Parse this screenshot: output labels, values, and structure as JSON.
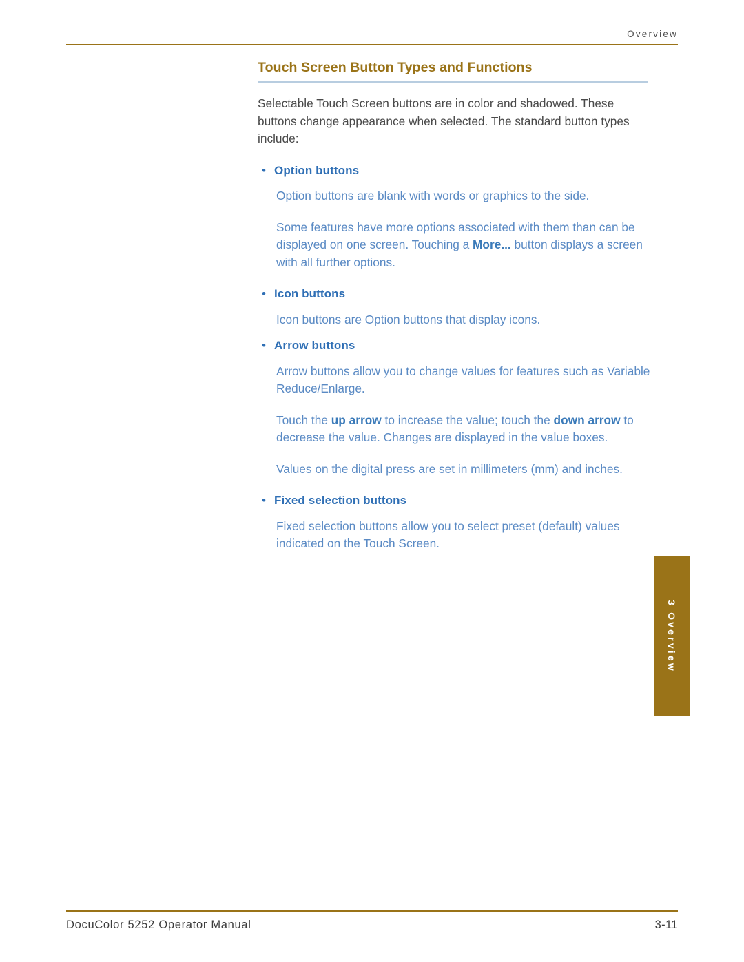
{
  "header": {
    "running_head": "Overview"
  },
  "title": "Touch Screen Button Types and Functions",
  "intro": "Selectable Touch Screen buttons are in color and shadowed. These buttons change appearance when selected. The standard button types include:",
  "sections": [
    {
      "bullet": "•",
      "label": "Option buttons",
      "paragraphs": [
        "Option buttons are blank with words or graphics to the side.",
        "Some features have more options associated with them than can be displayed on one screen. Touching a More... button displays a screen with all further options."
      ]
    },
    {
      "bullet": "•",
      "label": "Icon buttons",
      "paragraphs": [
        "Icon buttons are Option buttons that display icons."
      ]
    },
    {
      "bullet": "•",
      "label": "Arrow buttons",
      "paragraphs": [
        "Arrow buttons allow you to change values for features such as Variable Reduce/Enlarge.",
        "Touch the up arrow to increase the value; touch the down arrow to decrease the value. Changes are displayed in the value boxes.",
        "Values on the digital press are set in millimeters (mm) and inches."
      ]
    },
    {
      "bullet": "•",
      "label": "Fixed selection buttons",
      "paragraphs": [
        "Fixed selection buttons allow you to select preset (default) values indicated on the Touch Screen."
      ]
    }
  ],
  "inline_bold": {
    "more": "More...",
    "up_arrow": "up arrow",
    "down": "down",
    "arrow": "arrow"
  },
  "side_tab": {
    "label": "3  Overview"
  },
  "footer": {
    "left": "DocuColor 5252 Operator Manual",
    "right": "3-11"
  },
  "colors": {
    "accent_gold": "#9a7318",
    "link_blue": "#5a8ac4",
    "heading_blue": "#2f6fb5",
    "rule_blue": "#b8cde0"
  }
}
